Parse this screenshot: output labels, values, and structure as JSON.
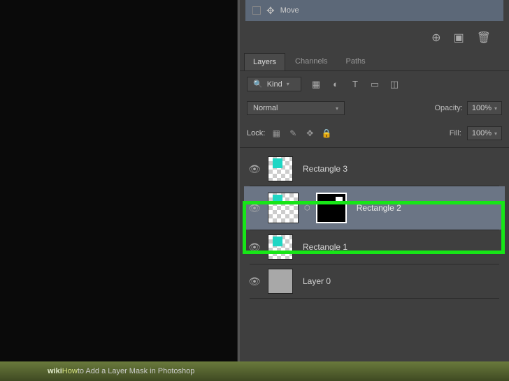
{
  "move_tool": {
    "label": "Move"
  },
  "tabs": {
    "layers": "Layers",
    "channels": "Channels",
    "paths": "Paths"
  },
  "filter": {
    "kind": "Kind"
  },
  "blend": {
    "mode": "Normal",
    "opacity_label": "Opacity:",
    "opacity_value": "100%"
  },
  "lock": {
    "label": "Lock:",
    "fill_label": "Fill:",
    "fill_value": "100%"
  },
  "layers": [
    {
      "name": "Rectangle 3"
    },
    {
      "name": "Rectangle 2"
    },
    {
      "name": "Rectangle 1"
    },
    {
      "name": "Layer 0"
    }
  ],
  "caption": {
    "wiki": "wiki",
    "how": "How",
    "text": " to Add a Layer Mask in Photoshop"
  }
}
